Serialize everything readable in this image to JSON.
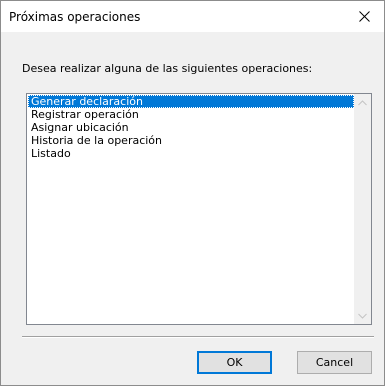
{
  "window": {
    "title": "Próximas operaciones",
    "close_icon": "close-icon"
  },
  "prompt": "Desea realizar alguna de las siguientes operaciones:",
  "options": {
    "selected_index": 0,
    "items": [
      {
        "label": "Generar declaración"
      },
      {
        "label": "Registrar operación"
      },
      {
        "label": "Asignar ubicación"
      },
      {
        "label": "Historia de la operación"
      },
      {
        "label": "Listado"
      }
    ]
  },
  "buttons": {
    "ok_label": "OK",
    "cancel_label": "Cancel"
  },
  "colors": {
    "selection": "#0078d7",
    "dialog_background": "#f0f0f0",
    "focus_border": "#0078d7"
  }
}
